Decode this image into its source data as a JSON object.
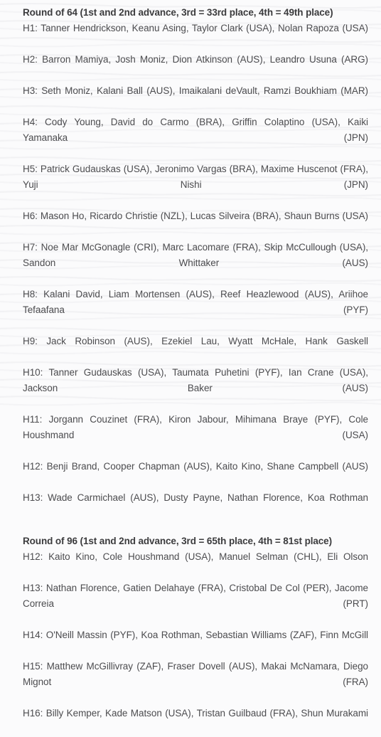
{
  "document": {
    "title": "Heat Draw",
    "background_color": "#fbfbfc",
    "heading_color": "#3b3b3d",
    "body_color": "#4c4c4f"
  },
  "sections": [
    {
      "heading": "Round of 64 (1st and 2nd advance, 3rd = 33rd place, 4th = 49th place)",
      "heats": [
        "H1: Tanner Hendrickson, Keanu Asing, Taylor Clark (USA), Nolan Rapoza (USA)",
        "H2: Barron Mamiya, Josh Moniz, Dion Atkinson (AUS), Leandro Usuna (ARG)",
        "H3: Seth Moniz, Kalani Ball (AUS), Imaikalani deVault, Ramzi Boukhiam (MAR)",
        "H4: Cody Young, David do Carmo (BRA), Griffin Colaptino (USA), Kaiki Yamanaka (JPN)",
        "H5: Patrick Gudauskas (USA), Jeronimo Vargas (BRA), Maxime Huscenot (FRA), Yuji Nishi (JPN)",
        "H6: Mason Ho, Ricardo Christie (NZL), Lucas Silveira (BRA), Shaun Burns (USA)",
        "H7: Noe Mar McGonagle (CRI), Marc Lacomare (FRA), Skip McCullough (USA), Sandon Whittaker (AUS)",
        "H8: Kalani David, Liam Mortensen (AUS), Reef Heazlewood (AUS), Ariihoe Tefaafana (PYF)",
        "H9: Jack Robinson (AUS), Ezekiel Lau, Wyatt McHale, Hank Gaskell",
        "H10: Tanner Gudauskas (USA), Taumata Puhetini (PYF), Ian Crane (USA), Jackson Baker (AUS)",
        "H11: Jorgann Couzinet (FRA), Kiron Jabour, Mihimana Braye (PYF), Cole Houshmand (USA)",
        "H12: Benji Brand, Cooper Chapman (AUS), Kaito Kino, Shane Campbell (AUS)",
        "H13: Wade Carmichael (AUS), Dusty Payne, Nathan Florence, Koa Rothman"
      ]
    },
    {
      "heading": "Round of 96 (1st and 2nd advance, 3rd = 65th place, 4th = 81st place)",
      "heats": [
        "H12: Kaito Kino, Cole Houshmand (USA), Manuel Selman (CHL), Eli Olson",
        "H13: Nathan Florence, Gatien Delahaye (FRA), Cristobal De Col (PER), Jacome Correia (PRT)",
        "H14: O'Neill Massin (PYF), Koa Rothman, Sebastian Williams (ZAF), Finn McGill",
        "H15: Matthew McGillivray (ZAF), Fraser Dovell (AUS), Makai McNamara, Diego Mignot (FRA)",
        "H16: Billy Kemper, Kade Matson (USA), Tristan Guilbaud (FRA), Shun Murakami"
      ]
    }
  ]
}
